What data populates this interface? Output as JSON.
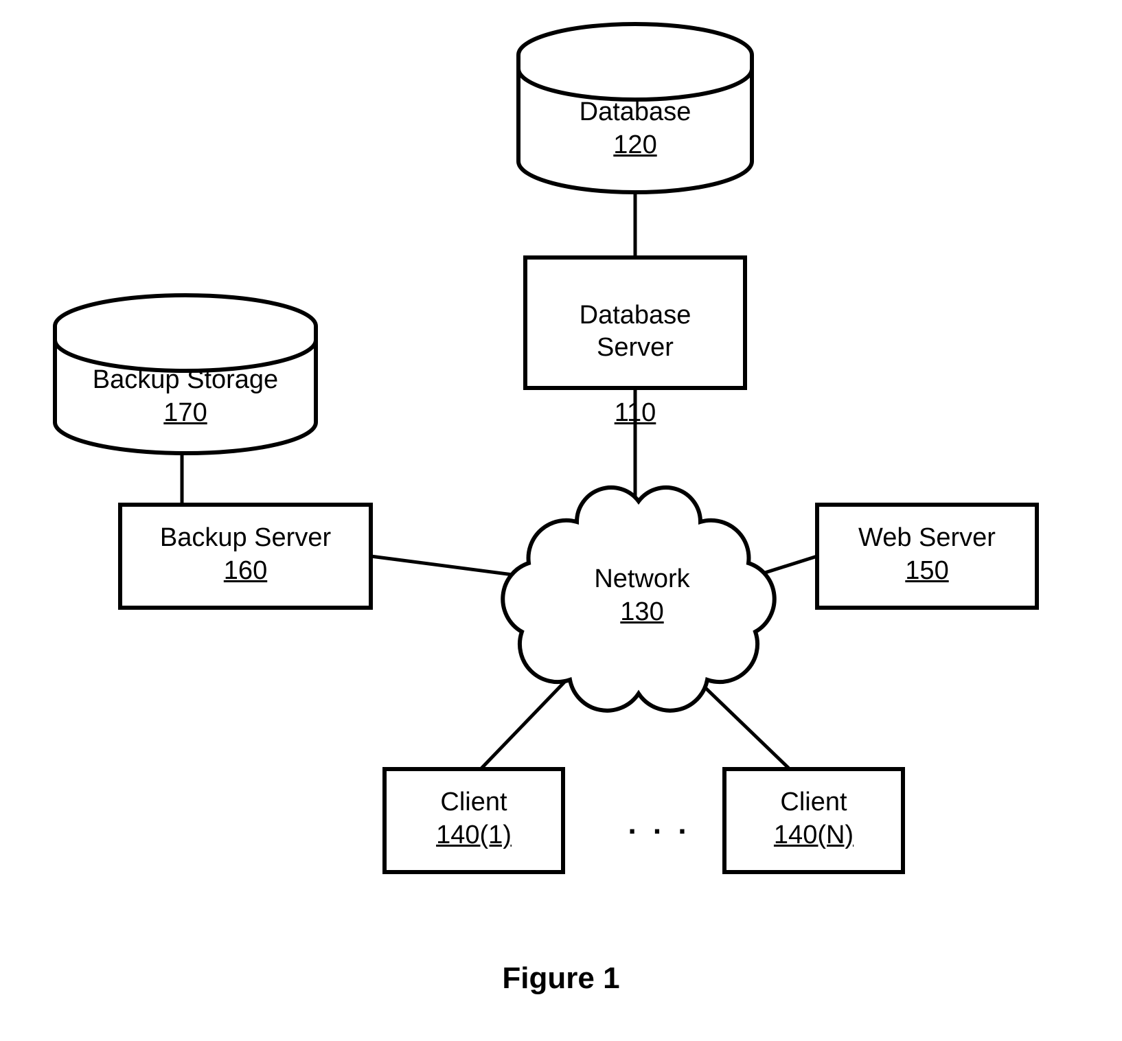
{
  "figure_caption": "Figure 1",
  "nodes": {
    "database": {
      "name": "Database",
      "ref": "120"
    },
    "database_server": {
      "name": "Database\nServer",
      "ref": "110"
    },
    "backup_storage": {
      "name": "Backup Storage",
      "ref": "170"
    },
    "backup_server": {
      "name": "Backup Server",
      "ref": "160"
    },
    "network": {
      "name": "Network",
      "ref": "130"
    },
    "web_server": {
      "name": "Web Server",
      "ref": "150"
    },
    "client_first": {
      "name": "Client",
      "ref": "140(1)"
    },
    "client_last": {
      "name": "Client",
      "ref": "140(N)"
    },
    "ellipsis": ". . ."
  }
}
